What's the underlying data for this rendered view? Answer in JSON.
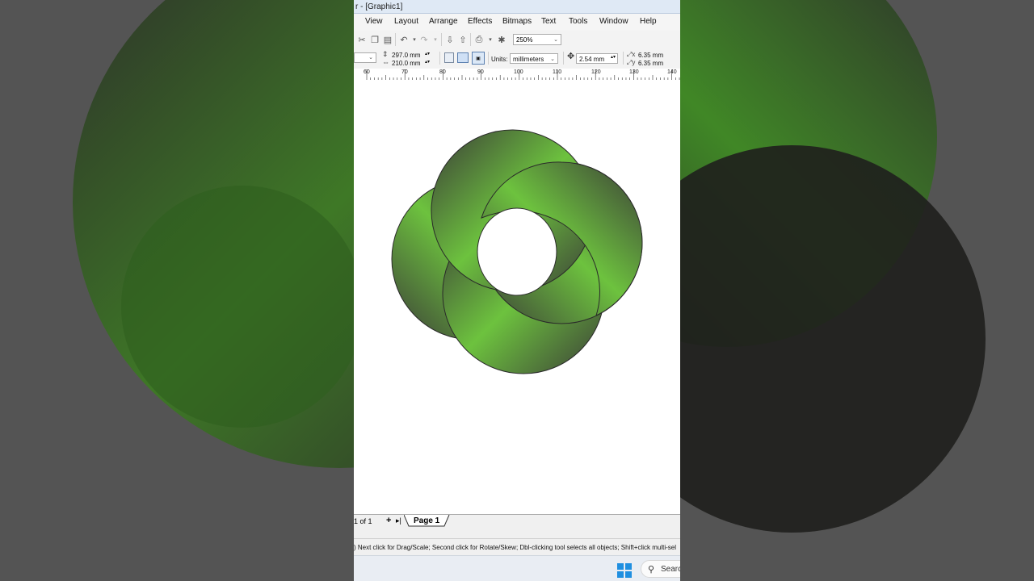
{
  "window": {
    "title": "r - [Graphic1]"
  },
  "menu": [
    {
      "label": "View"
    },
    {
      "label": "Layout"
    },
    {
      "label": "Arrange"
    },
    {
      "label": "Effects"
    },
    {
      "label": "Bitmaps"
    },
    {
      "label": "Text"
    },
    {
      "label": "Tools"
    },
    {
      "label": "Window"
    },
    {
      "label": "Help"
    }
  ],
  "toolbar": {
    "zoom_value": "250%",
    "icons": [
      "cut-icon",
      "copy-icon",
      "paste-icon",
      "undo-icon",
      "redo-icon",
      "import-icon",
      "export-icon",
      "print-icon",
      "zoom-tool-icon"
    ]
  },
  "property_bar": {
    "page_width": "297.0 mm",
    "page_height": "210.0 mm",
    "units_label": "Units:",
    "units_value": "millimeters",
    "nudge_value": "2.54 mm",
    "duplicate_x": "6.35 mm",
    "duplicate_y": "6.35 mm"
  },
  "ruler": {
    "ticks": [
      "60",
      "70",
      "80",
      "90",
      "100",
      "110",
      "120",
      "130",
      "140"
    ]
  },
  "canvas": {
    "colors": {
      "green": "#6dc23e",
      "dark": "#3b3d38",
      "outline": "#2a2a2a"
    }
  },
  "page_nav": {
    "count": "1 of 1",
    "tab": "Page 1"
  },
  "status": {
    "hint": ")    Next click for Drag/Scale; Second click for Rotate/Skew; Dbl-clicking tool selects all objects; Shift+click multi-sel"
  },
  "taskbar": {
    "search_label": "Search"
  }
}
